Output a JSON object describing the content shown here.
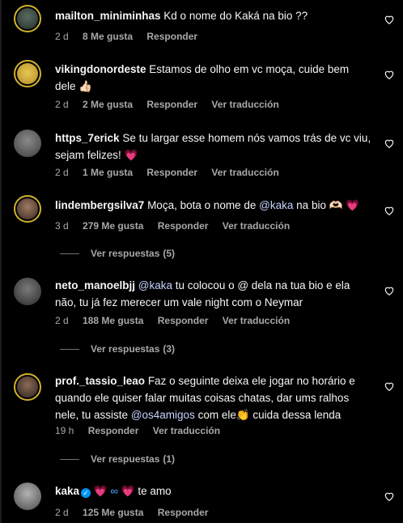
{
  "comments": [
    {
      "username": "mailton_miniminhas",
      "text": "Kd o nome do Kaká na bio ??",
      "time": "2 d",
      "likes": "8 Me gusta",
      "reply": "Responder"
    },
    {
      "username": "vikingdonordeste",
      "text": "Estamos de olho em vc moça, cuide bem dele 👍🏻",
      "time": "2 d",
      "likes": "2 Me gusta",
      "reply": "Responder",
      "translate": "Ver traducción"
    },
    {
      "username": "https_7erick",
      "text": "Se tu largar esse homem nós vamos trás de vc viu, sejam felizes!",
      "emoji": "💗",
      "time": "2 d",
      "likes": "1 Me gusta",
      "reply": "Responder",
      "translate": "Ver traducción"
    },
    {
      "username": "lindembergsilva7",
      "pre": "Moça, bota o nome de",
      "mention": "@kaka",
      "post": "na bio 🫶🏻",
      "emoji": "💗",
      "time": "3 d",
      "likes": "279 Me gusta",
      "reply": "Responder",
      "translate": "Ver traducción",
      "replies_label": "Ver respuestas",
      "replies_count": "(5)"
    },
    {
      "username": "neto_manoelbjj",
      "mention": "@kaka",
      "post": "tu colocou o @ dela na tua bio e ela não, tu já fez merecer um vale night com o Neymar",
      "time": "2 d",
      "likes": "188 Me gusta",
      "reply": "Responder",
      "translate": "Ver traducción",
      "replies_label": "Ver respuestas",
      "replies_count": "(3)"
    },
    {
      "username": "prof._tassio_leao",
      "pre": "Faz o seguinte deixa ele jogar no horário e quando ele quiser falar muitas coisas chatas, dar ums ralhos nele, tu assiste",
      "mention": "@os4amigos",
      "post": "com ele👏 cuida dessa lenda",
      "time": "19 h",
      "reply": "Responder",
      "translate": "Ver traducción",
      "replies_label": "Ver respuestas",
      "replies_count": "(1)"
    },
    {
      "username": "kaka",
      "heart1": "💗",
      "infinity": "∞",
      "heart2": "💗",
      "text": "te amo",
      "time": "2 d",
      "likes": "125 Me gusta",
      "reply": "Responder"
    }
  ],
  "colors": {
    "background": "#000000",
    "text": "#f5f5f5",
    "muted": "#a8a8a8",
    "mention": "#c7d2fe",
    "verified": "#0095f6"
  },
  "icons": {
    "like": "heart-outline-icon",
    "verified": "verified-badge-icon"
  }
}
